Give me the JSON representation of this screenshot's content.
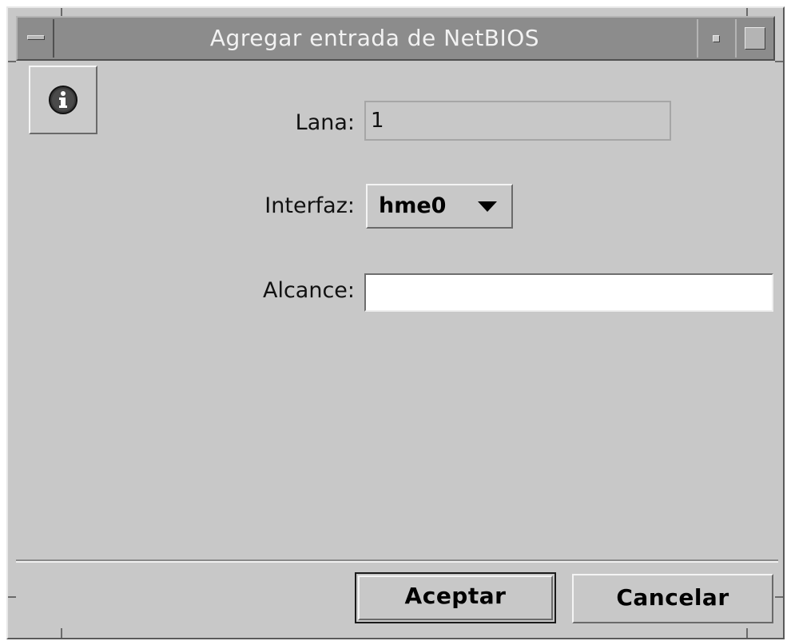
{
  "window": {
    "title": "Agregar entrada de NetBIOS"
  },
  "form": {
    "lana_label": "Lana:",
    "lana_value": "1",
    "interfaz_label": "Interfaz:",
    "interfaz_value": "hme0",
    "alcance_label": "Alcance:",
    "alcance_value": ""
  },
  "buttons": {
    "accept": "Aceptar",
    "cancel": "Cancelar"
  },
  "icons": {
    "info": "info-icon",
    "window_menu": "window-menu-icon",
    "minimize": "minimize-icon",
    "maximize": "maximize-icon",
    "dropdown": "chevron-down-icon"
  }
}
